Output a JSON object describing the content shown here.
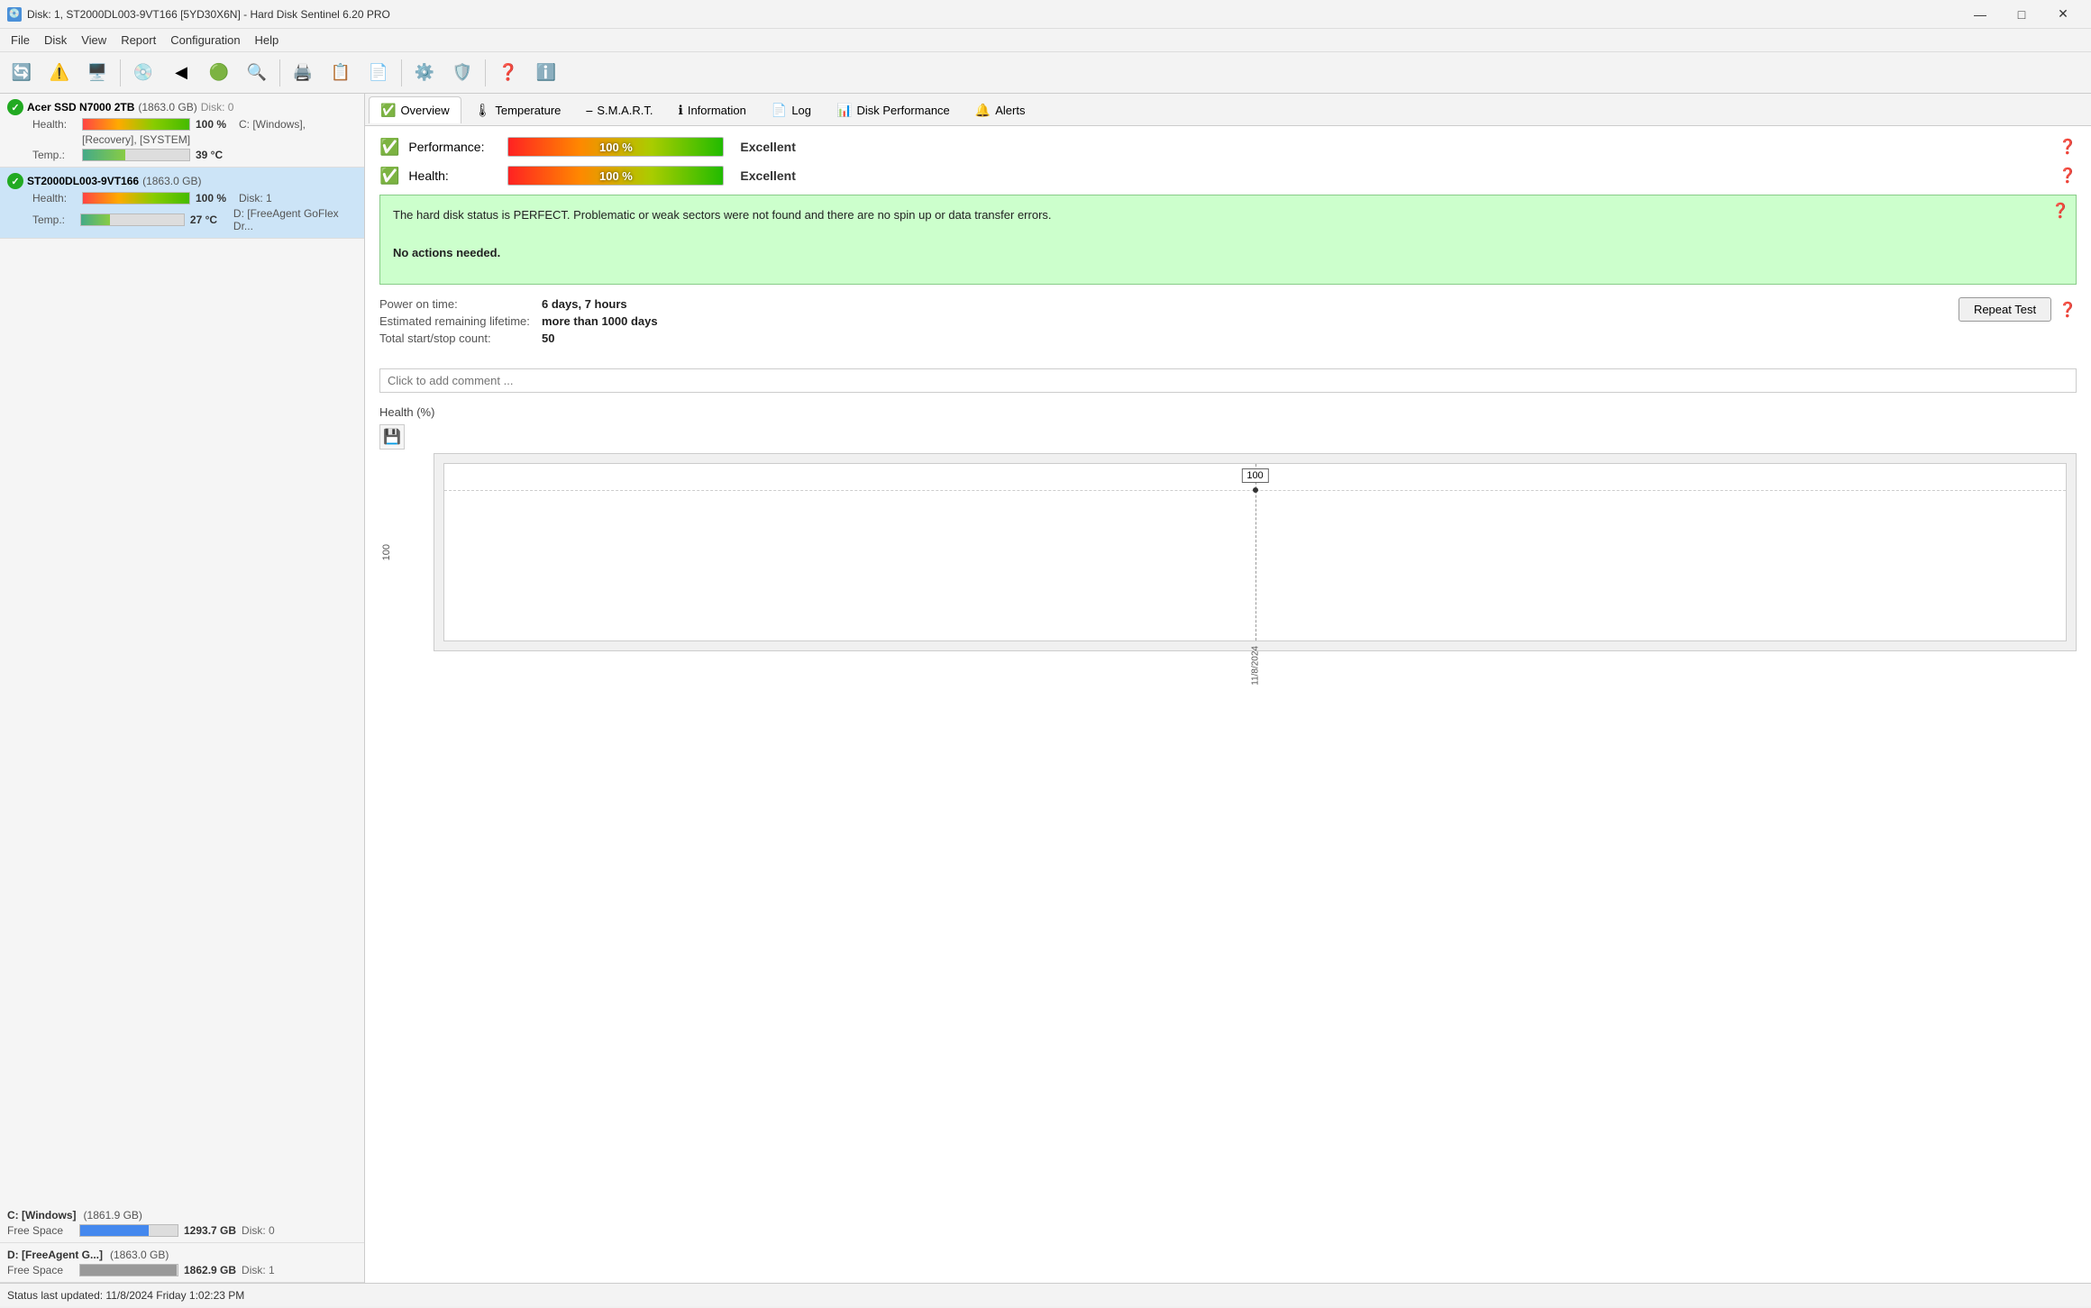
{
  "window": {
    "title": "Disk: 1, ST2000DL003-9VT166 [5YD30X6N]  -  Hard Disk Sentinel 6.20 PRO",
    "icon": "💿"
  },
  "menu": {
    "items": [
      "File",
      "Disk",
      "View",
      "Report",
      "Configuration",
      "Help"
    ]
  },
  "toolbar": {
    "buttons": [
      {
        "name": "refresh-icon",
        "icon": "🔄"
      },
      {
        "name": "warning-icon",
        "icon": "⚠"
      },
      {
        "name": "disk-icon",
        "icon": "💾"
      },
      {
        "name": "record-icon",
        "icon": "📀"
      },
      {
        "name": "back-icon",
        "icon": "◀"
      },
      {
        "name": "circle-icon",
        "icon": "🟢"
      },
      {
        "name": "search-icon",
        "icon": "🔍"
      },
      {
        "name": "print-icon",
        "icon": "🖨"
      },
      {
        "name": "copy-icon",
        "icon": "📋"
      },
      {
        "name": "export-icon",
        "icon": "📄"
      },
      {
        "name": "settings-icon",
        "icon": "⚙"
      },
      {
        "name": "shield-icon",
        "icon": "🛡"
      },
      {
        "name": "help-icon",
        "icon": "❓"
      },
      {
        "name": "info-icon",
        "icon": "ℹ"
      }
    ]
  },
  "left_panel": {
    "disks": [
      {
        "id": "disk0",
        "name": "Acer SSD N7000 2TB",
        "size": "(1863.0 GB)",
        "disk_num": "Disk: 0",
        "selected": false,
        "health_percent": 100,
        "health_label": "100 %",
        "health_info": "C: [Windows],",
        "health_extra": "[Recovery], [SYSTEM]",
        "temp_celsius": "39 °C",
        "temp_info": ""
      },
      {
        "id": "disk1",
        "name": "ST2000DL003-9VT166",
        "size": "(1863.0 GB)",
        "disk_num": "",
        "selected": true,
        "health_percent": 100,
        "health_label": "100 %",
        "health_info": "Disk: 1",
        "temp_celsius": "27 °C",
        "temp_info": "D: [FreeAgent GoFlex Dr..."
      }
    ],
    "volumes": [
      {
        "id": "vol-c",
        "label": "C: [Windows]",
        "size": "(1861.9 GB)",
        "free_space": "1293.7 GB",
        "free_bar_pct": 70,
        "disk_ref": "Disk: 0",
        "bar_type": "blue"
      },
      {
        "id": "vol-d",
        "label": "D: [FreeAgent G...]",
        "size": "(1863.0 GB)",
        "free_space": "1862.9 GB",
        "free_bar_pct": 99,
        "disk_ref": "Disk: 1",
        "bar_type": "gray"
      }
    ]
  },
  "right_panel": {
    "tabs": [
      {
        "id": "overview",
        "label": "Overview",
        "icon": "✅",
        "active": true
      },
      {
        "id": "temperature",
        "label": "Temperature",
        "icon": "🌡"
      },
      {
        "id": "smart",
        "label": "S.M.A.R.T.",
        "icon": "—"
      },
      {
        "id": "information",
        "label": "Information",
        "icon": "ℹ"
      },
      {
        "id": "log",
        "label": "Log",
        "icon": "📄"
      },
      {
        "id": "disk-performance",
        "label": "Disk Performance",
        "icon": "📊"
      },
      {
        "id": "alerts",
        "label": "Alerts",
        "icon": "🔔"
      }
    ],
    "overview": {
      "performance": {
        "label": "Performance:",
        "percent": "100 %",
        "status": "Excellent"
      },
      "health": {
        "label": "Health:",
        "percent": "100 %",
        "status": "Excellent"
      },
      "status_message": "The hard disk status is PERFECT. Problematic or weak sectors were not found and there are no spin up or data transfer errors.",
      "no_action": "No actions needed.",
      "power_on_time_label": "Power on time:",
      "power_on_time_value": "6 days, 7 hours",
      "estimated_lifetime_label": "Estimated remaining lifetime:",
      "estimated_lifetime_value": "more than 1000 days",
      "start_stop_label": "Total start/stop count:",
      "start_stop_value": "50",
      "comment_placeholder": "Click to add comment ...",
      "repeat_test_label": "Repeat Test",
      "chart_title": "Health (%)",
      "chart_save_icon": "💾",
      "chart_data": {
        "y_label": "100",
        "x_label": "11/8/2024",
        "point_value": "100",
        "point_x_pct": 50,
        "point_y_pct": 15
      }
    }
  },
  "status_bar": {
    "text": "Status last updated: 11/8/2024 Friday 1:02:23 PM"
  }
}
